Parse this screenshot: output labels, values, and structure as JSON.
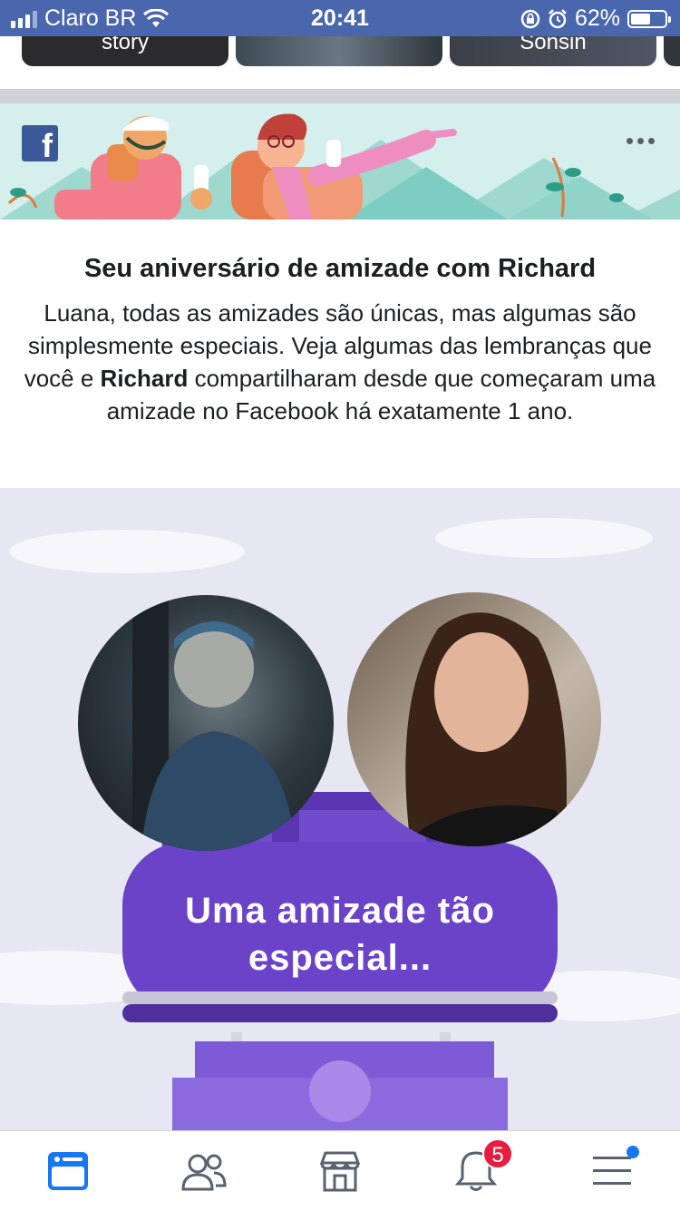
{
  "status_bar": {
    "carrier": "Claro BR",
    "time": "20:41",
    "battery_percent": "62%",
    "battery_level": 0.62,
    "icons": [
      "signal-icon",
      "wifi-icon",
      "rotation-lock-icon",
      "alarm-icon",
      "battery-icon"
    ]
  },
  "stories": {
    "items": [
      {
        "label": "story"
      },
      {
        "label": ""
      },
      {
        "label": "Sonsin"
      },
      {
        "label": ""
      }
    ]
  },
  "memory_card": {
    "logo": "f",
    "more_icon": "more-icon",
    "title": "Seu aniversário de amizade com Richard",
    "body_part1": "Luana, todas as amizades são únicas, mas algumas são simplesmente especiais. Veja algumas das lembranças que você e ",
    "body_bold": "Richard",
    "body_part2": " compartilharam desde que começaram uma amizade no Facebook há exatamente 1 ano.",
    "video_caption": "Uma amizade tão especial..."
  },
  "bottom_nav": {
    "items": [
      {
        "name": "news-feed",
        "icon": "news-feed-icon",
        "active": true
      },
      {
        "name": "friends",
        "icon": "friends-icon"
      },
      {
        "name": "marketplace",
        "icon": "marketplace-icon"
      },
      {
        "name": "notifications",
        "icon": "bell-icon",
        "badge": "5"
      },
      {
        "name": "menu",
        "icon": "menu-icon"
      }
    ]
  },
  "colors": {
    "facebook_blue": "#3b5998",
    "status_bar": "#4a67ad",
    "active_nav": "#1877f2",
    "badge_red": "#e41e3f",
    "car_purple": "#6a43c8"
  }
}
